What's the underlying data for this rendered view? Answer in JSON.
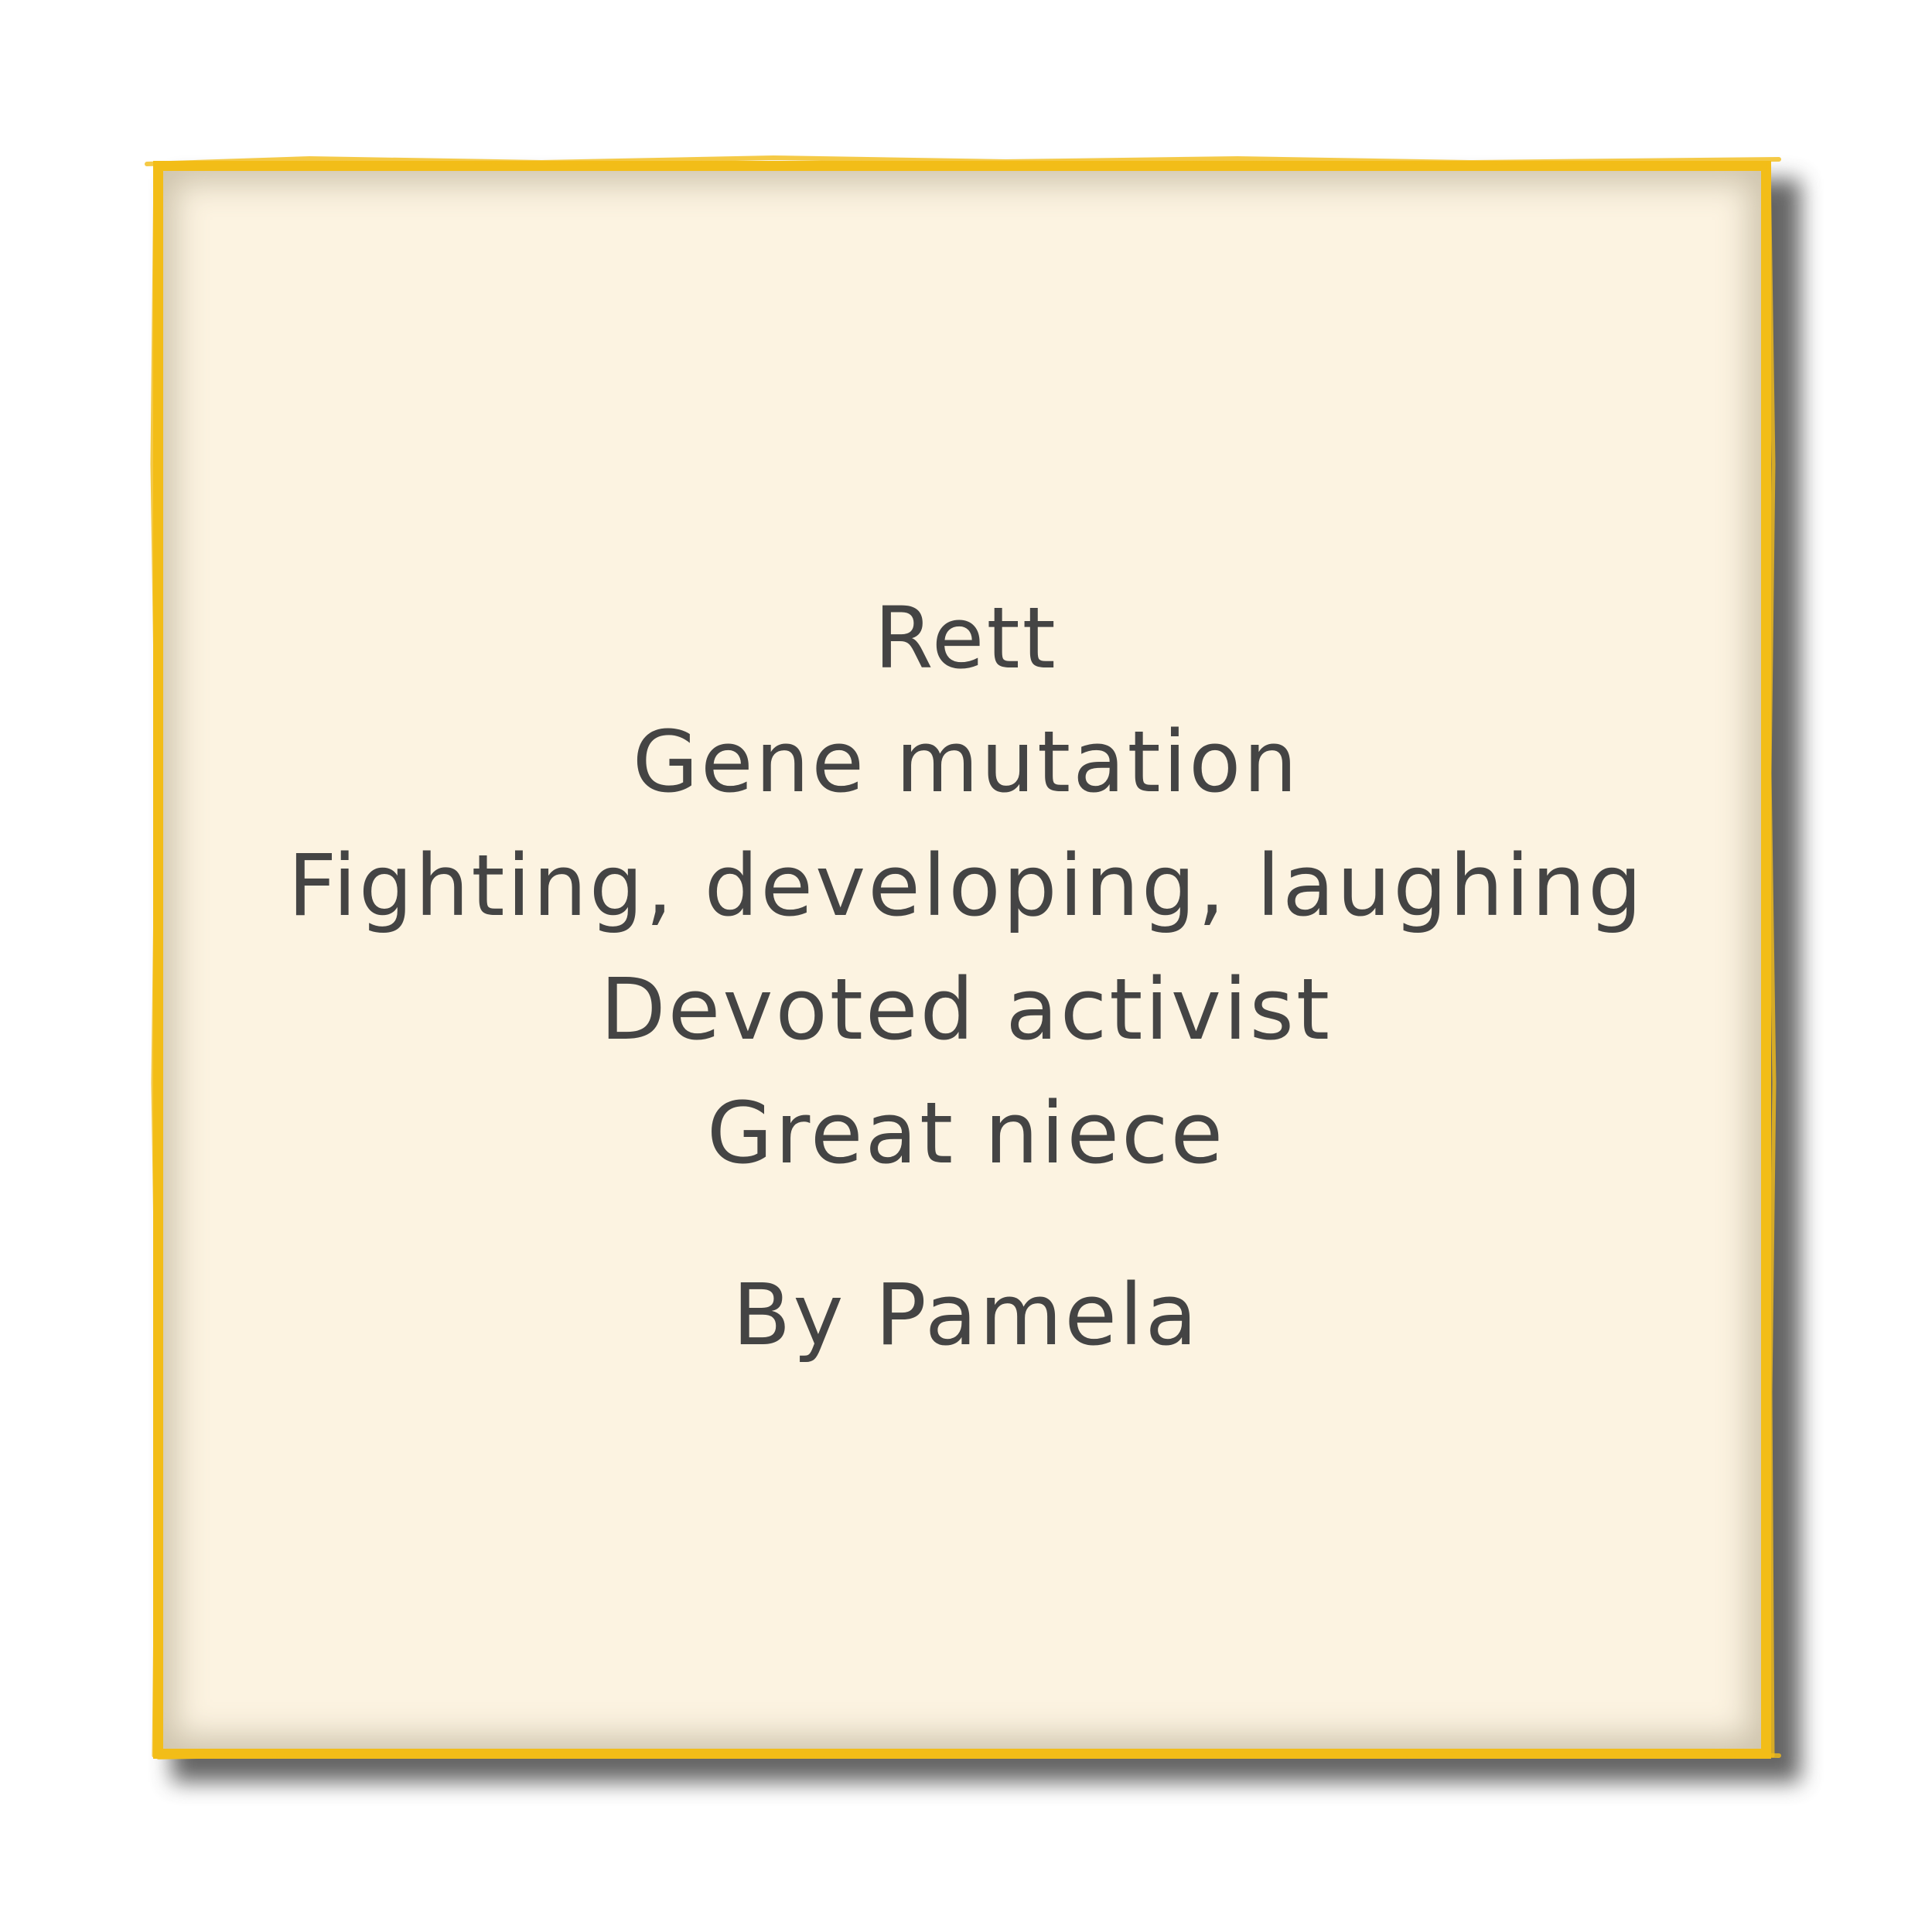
{
  "poem": {
    "lines": [
      "Rett",
      "Gene mutation",
      "Fighting, developing, laughing",
      "Devoted activist",
      "Great niece"
    ],
    "author": "By Pamela"
  },
  "colors": {
    "background": "#ffffff",
    "card": "#fcf3e1",
    "border": "#f2bd18",
    "shadow": "#4a4a4a",
    "text": "#444444"
  }
}
